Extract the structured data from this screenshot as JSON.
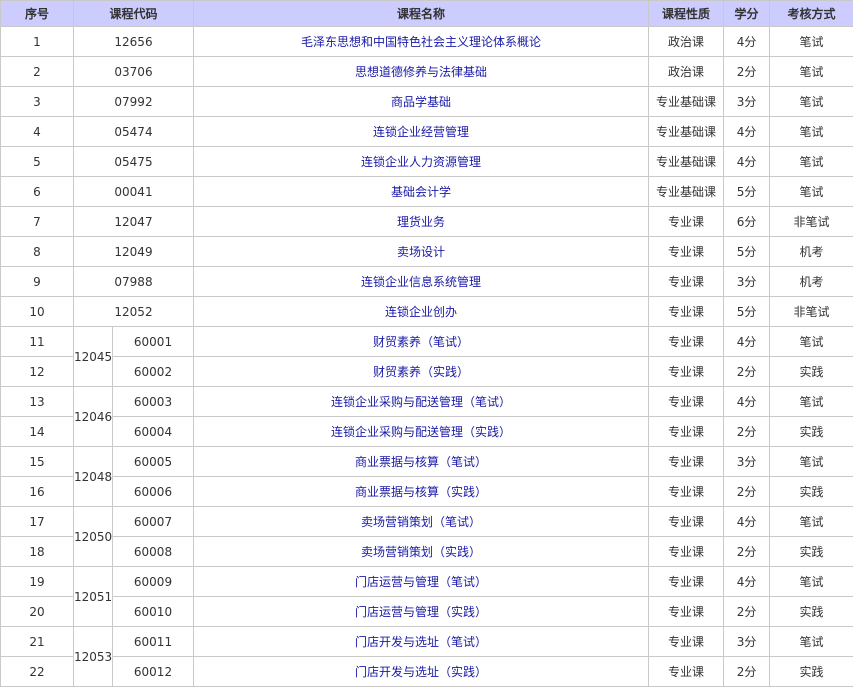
{
  "headers": [
    "序号",
    "课程代码",
    "课程名称",
    "课程性质",
    "学分",
    "考核方式"
  ],
  "rows": [
    {
      "no": "1",
      "group": "",
      "code": "12656",
      "name": "毛泽东思想和中国特色社会主义理论体系概论",
      "type": "政治课",
      "credit": "4分",
      "exam": "笔试"
    },
    {
      "no": "2",
      "group": "",
      "code": "03706",
      "name": "思想道德修养与法律基础",
      "type": "政治课",
      "credit": "2分",
      "exam": "笔试"
    },
    {
      "no": "3",
      "group": "",
      "code": "07992",
      "name": "商品学基础",
      "type": "专业基础课",
      "credit": "3分",
      "exam": "笔试"
    },
    {
      "no": "4",
      "group": "",
      "code": "05474",
      "name": "连锁企业经营管理",
      "type": "专业基础课",
      "credit": "4分",
      "exam": "笔试"
    },
    {
      "no": "5",
      "group": "",
      "code": "05475",
      "name": "连锁企业人力资源管理",
      "type": "专业基础课",
      "credit": "4分",
      "exam": "笔试"
    },
    {
      "no": "6",
      "group": "",
      "code": "00041",
      "name": "基础会计学",
      "type": "专业基础课",
      "credit": "5分",
      "exam": "笔试"
    },
    {
      "no": "7",
      "group": "",
      "code": "12047",
      "name": "理货业务",
      "type": "专业课",
      "credit": "6分",
      "exam": "非笔试"
    },
    {
      "no": "8",
      "group": "",
      "code": "12049",
      "name": "卖场设计",
      "type": "专业课",
      "credit": "5分",
      "exam": "机考"
    },
    {
      "no": "9",
      "group": "",
      "code": "07988",
      "name": "连锁企业信息系统管理",
      "type": "专业课",
      "credit": "3分",
      "exam": "机考"
    },
    {
      "no": "10",
      "group": "",
      "code": "12052",
      "name": "连锁企业创办",
      "type": "专业课",
      "credit": "5分",
      "exam": "非笔试"
    },
    {
      "no": "11",
      "group": "12045",
      "code": "60001",
      "name": "财贸素养（笔试）",
      "type": "专业课",
      "credit": "4分",
      "exam": "笔试"
    },
    {
      "no": "12",
      "group": "12045",
      "code": "60002",
      "name": "财贸素养（实践）",
      "type": "专业课",
      "credit": "2分",
      "exam": "实践"
    },
    {
      "no": "13",
      "group": "12046",
      "code": "60003",
      "name": "连锁企业采购与配送管理（笔试）",
      "type": "专业课",
      "credit": "4分",
      "exam": "笔试"
    },
    {
      "no": "14",
      "group": "12046",
      "code": "60004",
      "name": "连锁企业采购与配送管理（实践）",
      "type": "专业课",
      "credit": "2分",
      "exam": "实践"
    },
    {
      "no": "15",
      "group": "12048",
      "code": "60005",
      "name": "商业票据与核算（笔试）",
      "type": "专业课",
      "credit": "3分",
      "exam": "笔试"
    },
    {
      "no": "16",
      "group": "12048",
      "code": "60006",
      "name": "商业票据与核算（实践）",
      "type": "专业课",
      "credit": "2分",
      "exam": "实践"
    },
    {
      "no": "17",
      "group": "12050",
      "code": "60007",
      "name": "卖场营销策划（笔试）",
      "type": "专业课",
      "credit": "4分",
      "exam": "笔试"
    },
    {
      "no": "18",
      "group": "12050",
      "code": "60008",
      "name": "卖场营销策划（实践）",
      "type": "专业课",
      "credit": "2分",
      "exam": "实践"
    },
    {
      "no": "19",
      "group": "12051",
      "code": "60009",
      "name": "门店运营与管理（笔试）",
      "type": "专业课",
      "credit": "4分",
      "exam": "笔试"
    },
    {
      "no": "20",
      "group": "12051",
      "code": "60010",
      "name": "门店运营与管理（实践）",
      "type": "专业课",
      "credit": "2分",
      "exam": "实践"
    },
    {
      "no": "21",
      "group": "12053",
      "code": "60011",
      "name": "门店开发与选址（笔试）",
      "type": "专业课",
      "credit": "3分",
      "exam": "笔试"
    },
    {
      "no": "22",
      "group": "12053",
      "code": "60012",
      "name": "门店开发与选址（实践）",
      "type": "专业课",
      "credit": "2分",
      "exam": "实践"
    }
  ],
  "colors": {
    "header_bg": "#ccccff",
    "link": "#1a1aa6",
    "border": "#c9c9c9"
  }
}
